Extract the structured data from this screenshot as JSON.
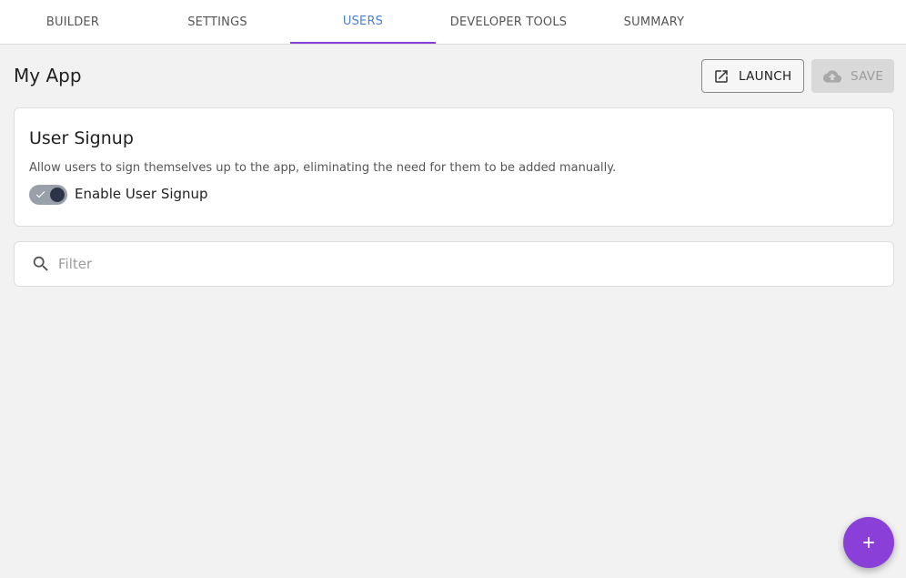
{
  "tabs": [
    {
      "label": "BUILDER",
      "active": false
    },
    {
      "label": "SETTINGS",
      "active": false
    },
    {
      "label": "USERS",
      "active": true
    },
    {
      "label": "DEVELOPER TOOLS",
      "active": false
    },
    {
      "label": "SUMMARY",
      "active": false
    }
  ],
  "header": {
    "title": "My App",
    "launch_label": "LAUNCH",
    "save_label": "SAVE",
    "launch_icon": "open-in-new-icon",
    "save_icon": "cloud-upload-icon"
  },
  "signup": {
    "title": "User Signup",
    "description": "Allow users to sign themselves up to the app, eliminating the need for them to be added manually.",
    "toggle_label": "Enable User Signup",
    "enabled": true
  },
  "filter": {
    "placeholder": "Filter",
    "value": "",
    "icon": "search-icon"
  },
  "fab": {
    "icon": "plus-icon"
  },
  "colors": {
    "accent": "#8a3fd8",
    "active_tab_text": "#4a7fd4",
    "background": "#f2f2f2"
  }
}
